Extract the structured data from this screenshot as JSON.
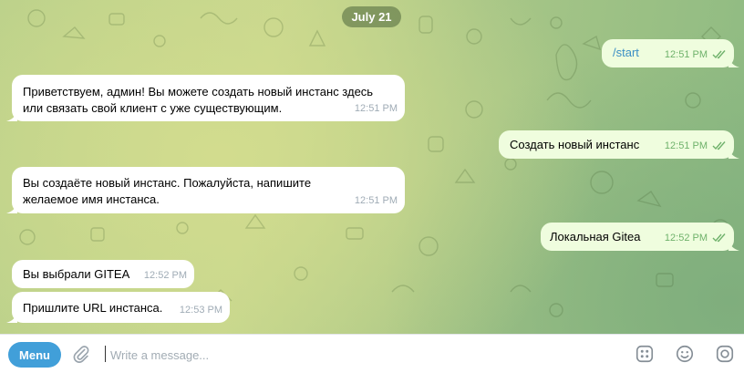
{
  "date_divider": "July 21",
  "messages": [
    {
      "dir": "out",
      "text": "/start",
      "time": "12:51 PM",
      "is_command": true
    },
    {
      "dir": "in",
      "text": "Приветствуем, админ! Вы можете создать новый инстанс здесь или связать свой клиент с уже существующим.",
      "time": "12:51 PM"
    },
    {
      "dir": "out",
      "text": "Создать новый инстанс",
      "time": "12:51 PM"
    },
    {
      "dir": "in",
      "text": "Вы создаёте новый инстанс. Пожалуйста, напишите желаемое имя инстанса.",
      "time": "12:51 PM"
    },
    {
      "dir": "out",
      "text": "Локальная Gitea",
      "time": "12:52 PM"
    },
    {
      "dir": "in",
      "text": "Вы выбрали GITEA",
      "time": "12:52 PM"
    },
    {
      "dir": "in",
      "text": "Пришлите URL инстанса.",
      "time": "12:53 PM"
    }
  ],
  "composer": {
    "menu_label": "Menu",
    "placeholder": "Write a message..."
  },
  "icons": {
    "attach": "paperclip-icon",
    "commands": "bot-commands-icon",
    "emoji": "emoji-icon",
    "camera": "camera-icon",
    "read": "double-check-icon"
  },
  "colors": {
    "menu_button": "#419fd9",
    "outgoing_bubble": "#effdde",
    "incoming_bubble": "#ffffff",
    "read_check": "#6fb26b",
    "command_link": "#3b8fc5"
  }
}
